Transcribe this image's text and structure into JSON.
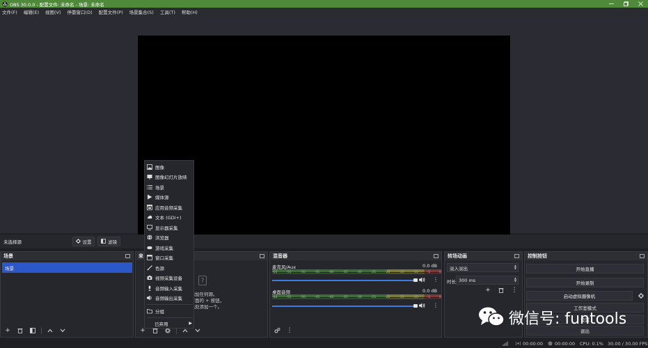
{
  "window": {
    "title": "OBS 30.0.0 - 配置文件: 未命名 - 场景: 未命名"
  },
  "menubar": [
    "文件(F)",
    "编辑(E)",
    "视图(V)",
    "停靠窗口(D)",
    "配置文件(P)",
    "场景集合(S)",
    "工具(T)",
    "帮助(H)"
  ],
  "source_bar": {
    "no_source": "未选择源",
    "settings": "设置",
    "filters": "滤镜"
  },
  "scenes": {
    "title": "场景",
    "items": [
      "场景"
    ]
  },
  "sources": {
    "title": "来",
    "empty_lines": [
      "未添加任何源。",
      "击下面的 + 按钮，",
      "在此处添加一个。"
    ]
  },
  "mixer": {
    "title": "混音器",
    "channels": [
      {
        "name": "麦克风/Aux",
        "db": "0.0 dB"
      },
      {
        "name": "桌面音频",
        "db": "0.0 dB"
      }
    ],
    "ticks": [
      "-60",
      "-55",
      "-50",
      "-45",
      "-40",
      "-35",
      "-30",
      "-25",
      "-20",
      "-15",
      "-10",
      "-5",
      "0"
    ]
  },
  "transitions": {
    "title": "转场动画",
    "selected": "淡入淡出",
    "duration_label": "时长",
    "duration": "300 ms"
  },
  "controls": {
    "title": "控制按钮",
    "buttons": [
      "开始直播",
      "开始录制",
      "启动虚拟摄像机",
      "工作室模式",
      "设置",
      "退出"
    ]
  },
  "context_menu": {
    "items": [
      "图像",
      "图像幻灯片放映",
      "场景",
      "媒体源",
      "应用音频采集",
      "文本 (GDI+)",
      "显示器采集",
      "浏览器",
      "游戏采集",
      "窗口采集",
      "色源",
      "视频采集设备",
      "音频输入采集",
      "音频输出采集",
      "分组",
      "已弃用"
    ],
    "icons": [
      "image-icon",
      "slideshow-icon",
      "list-icon",
      "play-icon",
      "app-audio-icon",
      "text-icon",
      "monitor-icon",
      "globe-icon",
      "gamepad-icon",
      "window-icon",
      "brush-icon",
      "camera-icon",
      "microphone-icon",
      "speaker-icon",
      "folder-icon",
      "submenu-arrow-icon"
    ]
  },
  "status": {
    "time1": "00:00:00",
    "time2": "00:00:00",
    "cpu": "CPU: 0.1%",
    "fps": "30.00 / 30.00 FPS"
  },
  "watermark": {
    "text": "微信号: funtools"
  },
  "colors": {
    "titlebar": "#4f8a3a",
    "scene_selected": "#2b57c9",
    "slider": "#3f7be0"
  }
}
